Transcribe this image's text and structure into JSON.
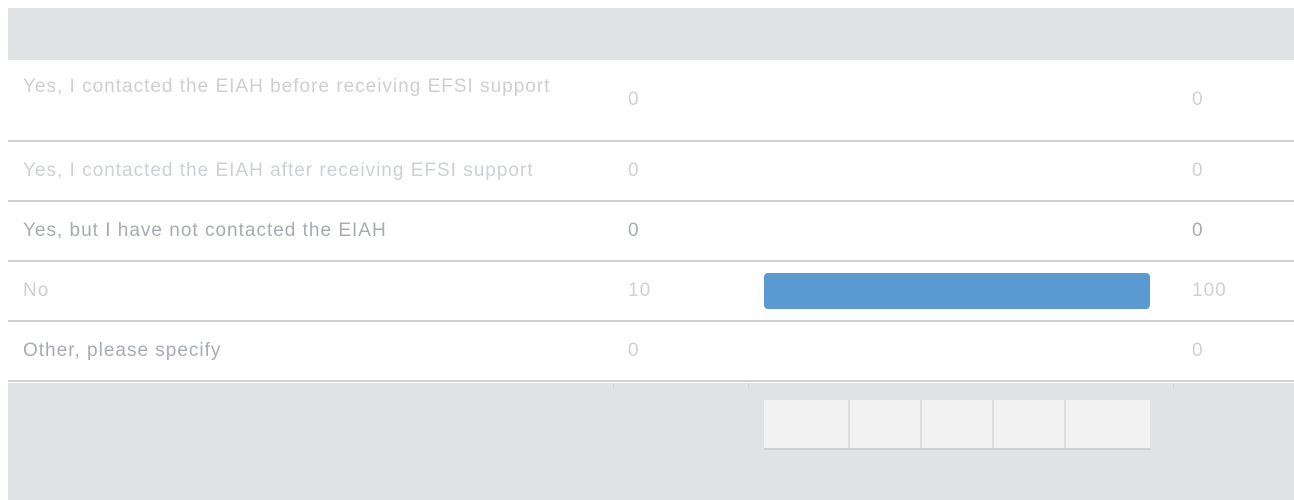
{
  "rows": [
    {
      "label": "Yes, I contacted the EIAH before receiving EFSI support",
      "count": "0",
      "percent": "0",
      "fraction": 0
    },
    {
      "label": "Yes, I contacted the EIAH after receiving EFSI support",
      "count": "0",
      "percent": "0",
      "fraction": 0
    },
    {
      "label": "Yes, but I have not contacted the EIAH",
      "count": "0",
      "percent": "0",
      "fraction": 0
    },
    {
      "label": "No",
      "count": "10",
      "percent": "100",
      "fraction": 1
    },
    {
      "label": "Other, please specify",
      "count": "0",
      "percent": "0",
      "fraction": 0
    }
  ],
  "colors": {
    "header": "#e1e2e4",
    "bar": "#5a9ad1",
    "text_light": "#cfd1d4",
    "text_mid": "#a8acb2"
  }
}
